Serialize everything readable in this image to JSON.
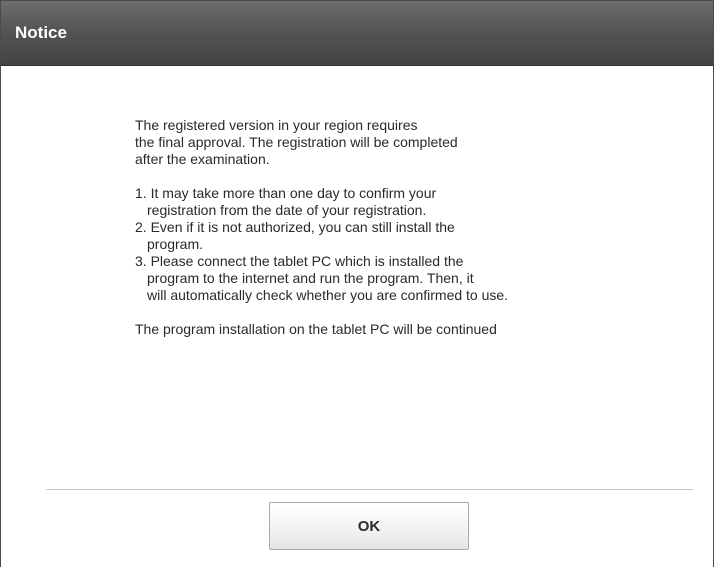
{
  "dialog": {
    "title": "Notice",
    "intro_lines": [
      "The registered version in your region requires",
      "the final approval. The registration will be completed",
      "after the examination."
    ],
    "items": [
      {
        "lines": [
          "1. It may take more than one day to confirm your",
          "registration from the date of your registration."
        ]
      },
      {
        "lines": [
          "2. Even if it is not authorized, you can still install the",
          "program."
        ]
      },
      {
        "lines": [
          "3. Please connect the tablet PC which is installed the",
          "program to the internet and run the program. Then, it",
          "will automatically check whether you are confirmed to use."
        ]
      }
    ],
    "footer_text": "The program installation on the tablet PC will be continued",
    "ok_label": "OK"
  }
}
